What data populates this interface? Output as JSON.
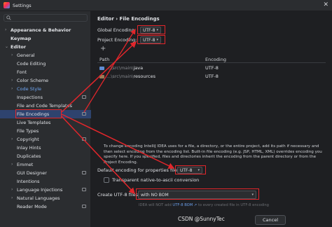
{
  "window": {
    "title": "Settings"
  },
  "sidebar": {
    "search_placeholder": "",
    "items": [
      {
        "label": "Appearance & Behavior",
        "chev": ">",
        "bold": true,
        "indent": 0
      },
      {
        "label": "Keymap",
        "chev": "",
        "bold": true,
        "indent": 0
      },
      {
        "label": "Editor",
        "chev": "v",
        "bold": true,
        "indent": 0
      },
      {
        "label": "General",
        "chev": ">",
        "indent": 1
      },
      {
        "label": "Code Editing",
        "chev": "",
        "indent": 1
      },
      {
        "label": "Font",
        "chev": "",
        "indent": 1
      },
      {
        "label": "Color Scheme",
        "chev": ">",
        "indent": 1
      },
      {
        "label": "Code Style",
        "chev": ">",
        "indent": 1,
        "blue": true
      },
      {
        "label": "Inspections",
        "chev": "",
        "indent": 1,
        "proj": true
      },
      {
        "label": "File and Code Templates",
        "chev": "",
        "indent": 1
      },
      {
        "label": "File Encodings",
        "chev": "",
        "indent": 1,
        "selected": true,
        "proj": true
      },
      {
        "label": "Live Templates",
        "chev": "",
        "indent": 1
      },
      {
        "label": "File Types",
        "chev": "",
        "indent": 1
      },
      {
        "label": "Copyright",
        "chev": ">",
        "indent": 1,
        "proj": true
      },
      {
        "label": "Inlay Hints",
        "chev": "",
        "indent": 1
      },
      {
        "label": "Duplicates",
        "chev": "",
        "indent": 1
      },
      {
        "label": "Emmet",
        "chev": ">",
        "indent": 1
      },
      {
        "label": "GUI Designer",
        "chev": "",
        "indent": 1,
        "proj": true
      },
      {
        "label": "Intentions",
        "chev": "",
        "indent": 1
      },
      {
        "label": "Language Injections",
        "chev": ">",
        "indent": 1,
        "proj": true
      },
      {
        "label": "Natural Languages",
        "chev": ">",
        "indent": 1
      },
      {
        "label": "Reader Mode",
        "chev": "",
        "indent": 1,
        "proj": true
      }
    ]
  },
  "main": {
    "breadcrumb": "Editor › File Encodings",
    "global_encoding_label": "Global Encoding:",
    "global_encoding_value": "UTF-8",
    "project_encoding_label": "Project Encoding:",
    "project_encoding_value": "UTF-8",
    "add_label": "+",
    "table": {
      "headers": [
        "Path",
        "Encoding"
      ],
      "rows": [
        {
          "path_dim": "...\\src\\main\\",
          "path_main": "java",
          "encoding": "UTF-8",
          "color": "#5f8dd3"
        },
        {
          "path_dim": "...\\src\\main\\",
          "path_main": "resources",
          "encoding": "UTF-8",
          "color": "#9a7b55"
        }
      ]
    },
    "info_text": "To change encoding IntelliJ IDEA uses for a file, a directory, or the entire project, add its path if necessary and then select encoding from the encoding list. Built-in file encoding (e.g. JSP, HTML, XML) overrides encoding you specify here. If you specified, files and directories inherit the encoding from the parent directory or from the Project Encoding.",
    "properties_label": "Default encoding for properties files:",
    "properties_value": "UTF-8",
    "transparent_label": "Transparent native-to-ascii conversion",
    "bom_label": "Create UTF-8 files:",
    "bom_value": "with NO BOM",
    "hint_prefix": "IDEA will NOT add ",
    "hint_link": "UTF-8 BOM ↗",
    "hint_suffix": " to every created file in UTF-8 encoding",
    "cancel_label": "Cancel"
  },
  "watermark": "CSDN @SunnyTec",
  "colors": {
    "accent": "#e2262b",
    "selection": "#2e436e",
    "link": "#6fa7f6"
  }
}
